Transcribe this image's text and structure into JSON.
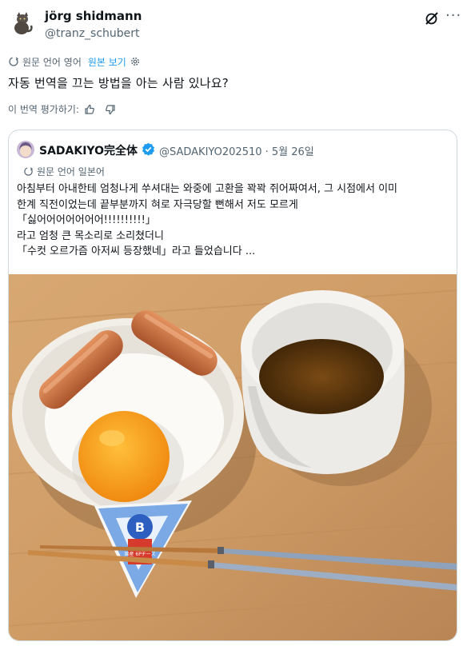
{
  "author": {
    "name": "jörg shidmann",
    "handle": "@tranz_schubert",
    "avatar_icon": "cat-avatar-icon"
  },
  "translation": {
    "source_label": "원문 언어 영어",
    "show_original_label": "원본 보기"
  },
  "tweet_text": "자동 번역을 끄는 방법을 아는 사람 있나요?",
  "rate_translation_label": "이 번역 평가하기:",
  "quoted": {
    "name": "SADAKIYO完全体",
    "handle_date": "@SADAKIYO202510 · 5월 26일",
    "translation_label": "원문 언어 일본어",
    "lines": [
      "아침부터 아내한테 엄청나게 쑤셔대는 와중에 고환을 꽉꽉 쥐어짜여서, 그 시점에서 이미",
      "한계 직전이었는데 끝부분까지 혀로 자극당할 뻔해서 저도 모르게",
      "「싫어어어어어어어!!!!!!!!!!」",
      "라고 엄청 큰 목소리로 소리쳤더니",
      "「수컷 오르가즘 아저씨 등장했네」라고 들었습니다  ..."
    ]
  },
  "icons": {
    "grok": "grok-icon",
    "more": "more-icon",
    "translate": "translate-icon",
    "settings": "gear-icon",
    "thumbs_up": "thumbs-up-icon",
    "thumbs_down": "thumbs-down-icon",
    "verified": "verified-badge-icon"
  },
  "photo": {
    "cheese_text": "国産 6Pチーズ",
    "cheese_letter": "B"
  }
}
